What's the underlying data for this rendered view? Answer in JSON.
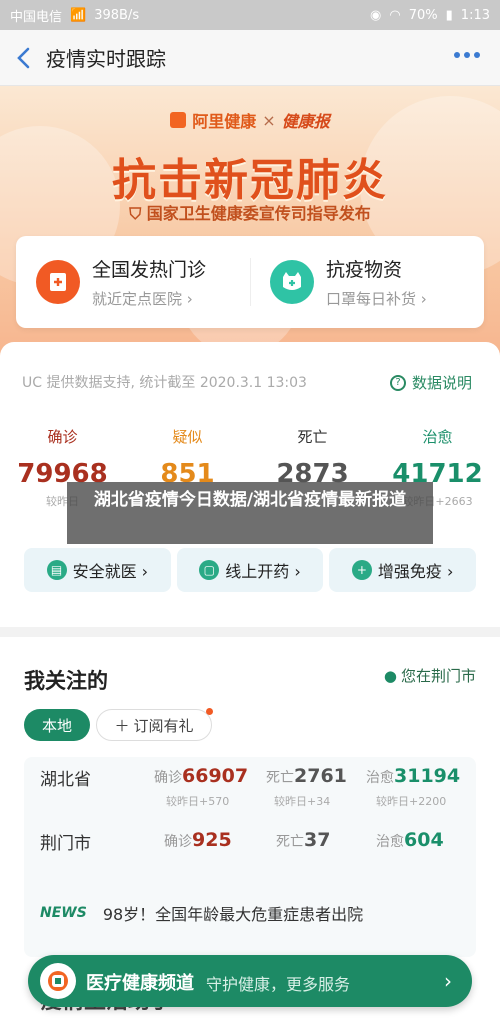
{
  "status": {
    "carrier": "中国电信",
    "speed": "398B/s",
    "battery": "70%",
    "time": "1:13"
  },
  "nav": {
    "title": "疫情实时跟踪"
  },
  "banner": {
    "brand_left": "阿里健康",
    "brand_x": "×",
    "brand_right": "健康报",
    "headline": "抗击新冠肺炎",
    "subline": "国家卫生健康委宣传司指导发布"
  },
  "quick": [
    {
      "title": "全国发热门诊",
      "sub": "就近定点医院 ›"
    },
    {
      "title": "抗疫物资",
      "sub": "口罩每日补货 ›"
    }
  ],
  "data": {
    "source": "UC 提供数据支持, 统计截至 2020.3.1 13:03",
    "explain": "数据说明",
    "stats": [
      {
        "label": "确诊",
        "value": "79968",
        "delta": "较昨日"
      },
      {
        "label": "疑似",
        "value": "851",
        "delta": ""
      },
      {
        "label": "死亡",
        "value": "2873",
        "delta": ""
      },
      {
        "label": "治愈",
        "value": "41712",
        "delta": "较昨日+2663"
      }
    ],
    "pills": [
      "安全就医 ›",
      "线上开药 ›",
      "增强免疫 ›"
    ]
  },
  "overlay_title": "湖北省疫情今日数据/湖北省疫情最新报道",
  "follow": {
    "title": "我关注的",
    "location": "您在荆门市",
    "tab_local": "本地",
    "tab_sub": "订阅有礼",
    "regions": [
      {
        "name": "湖北省",
        "confirmed_label": "确诊",
        "confirmed": "66907",
        "dead_label": "死亡",
        "dead": "2761",
        "cured_label": "治愈",
        "cured": "31194",
        "d1": "较昨日+570",
        "d2": "较昨日+34",
        "d3": "较昨日+2200"
      },
      {
        "name": "荆门市",
        "confirmed_label": "确诊",
        "confirmed": "925",
        "dead_label": "死亡",
        "dead": "37",
        "cured_label": "治愈",
        "cured": "604"
      }
    ],
    "news_badge": "NEWS",
    "news_text": "98岁！全国年龄最大危重症患者出院",
    "bg_text": "疫情生活助手"
  },
  "floatbar": {
    "title": "医疗健康频道",
    "sub": "守护健康，更多服务",
    "arrow": "›"
  }
}
